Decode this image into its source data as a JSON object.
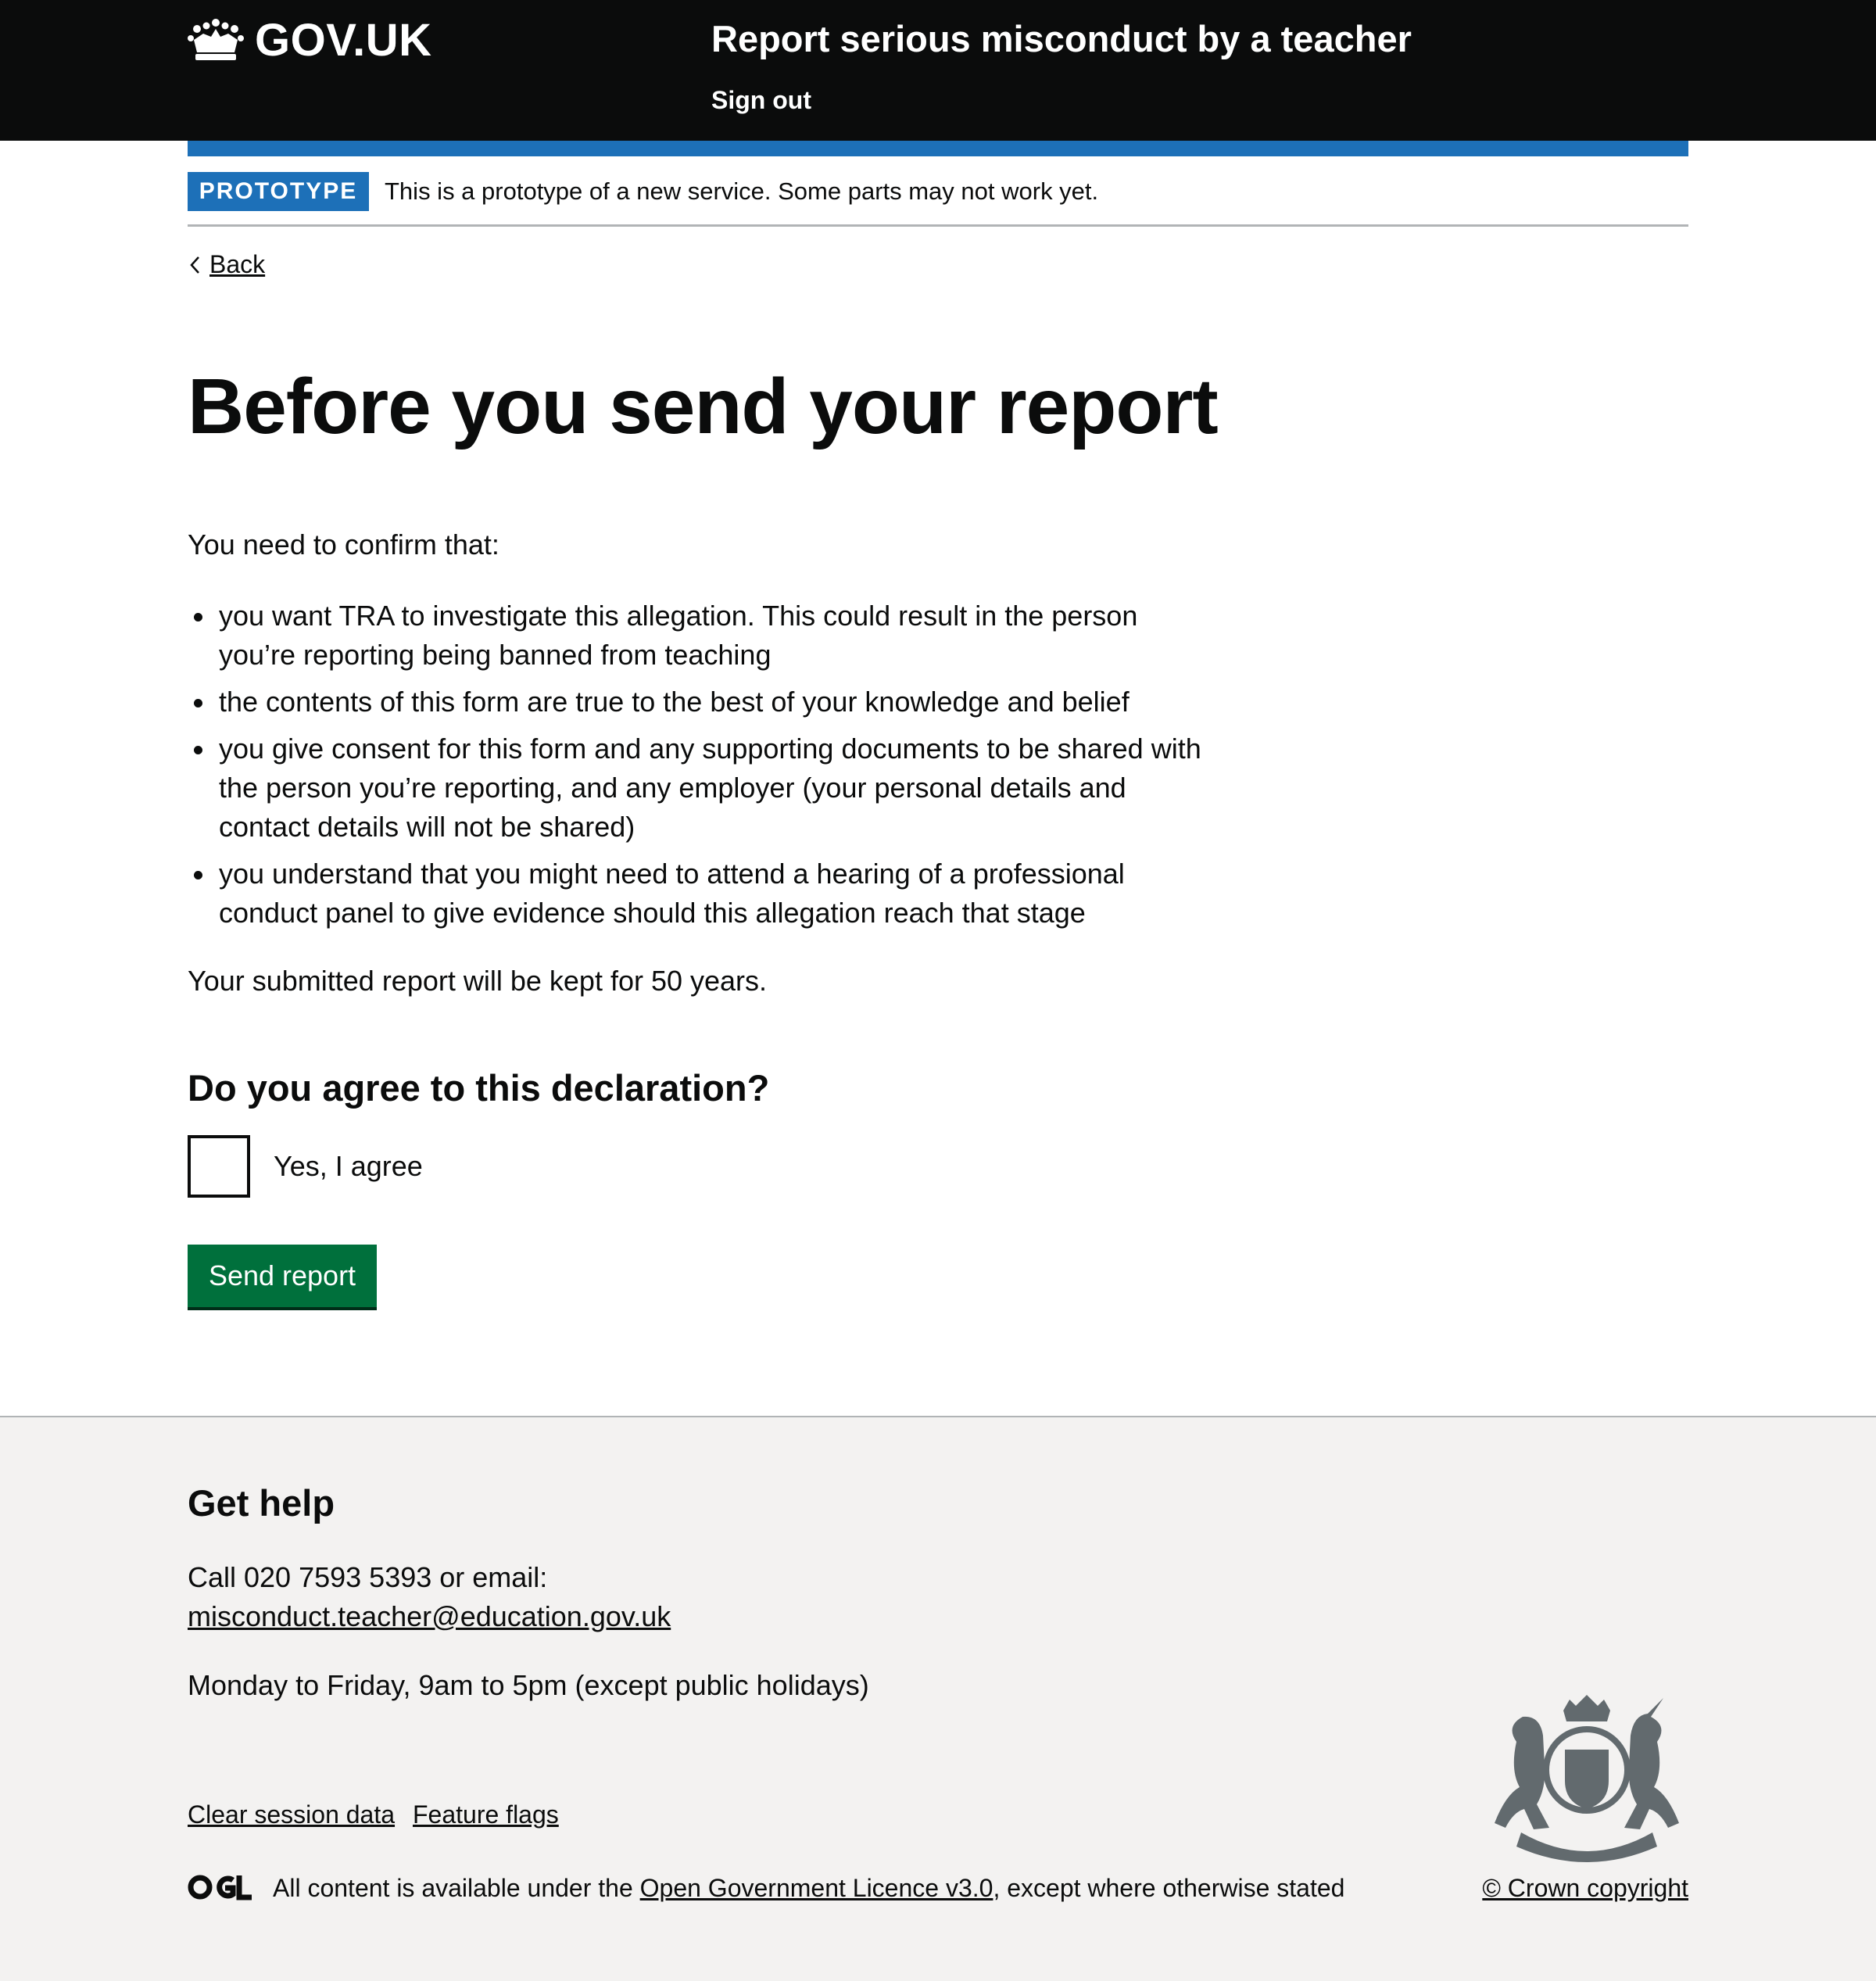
{
  "header": {
    "logo_text": "GOV.UK",
    "service_name": "Report serious misconduct by a teacher",
    "sign_out": "Sign out",
    "background": "#0b0c0c",
    "accent": "#1d70b8"
  },
  "phase_banner": {
    "tag": "PROTOTYPE",
    "text": "This is a prototype of a new service. Some parts may not work yet."
  },
  "back_link": "Back",
  "main": {
    "title": "Before you send your report",
    "intro": "You need to confirm that:",
    "bullets": [
      "you want TRA to investigate this allegation. This could result in the person you’re reporting being banned from teaching",
      "the contents of this form are true to the best of your knowledge and belief",
      "you give consent for this form and any supporting documents to be shared with the person you’re reporting, and any employer (your personal details and contact details will not be shared)",
      "you understand that you might need to attend a hearing of a professional conduct panel to give evidence should this allegation reach that stage"
    ],
    "retention": "Your submitted report will be kept for 50 years.",
    "question": "Do you agree to this declaration?",
    "checkbox_label": "Yes, I agree",
    "checkbox_checked": false,
    "submit_button": "Send report",
    "button_color": "#00703c"
  },
  "footer": {
    "help_heading": "Get help",
    "help_call": "Call 020 7593 5393 or email:",
    "help_email": "misconduct.teacher@education.gov.uk",
    "help_hours": "Monday to Friday, 9am to 5pm (except public holidays)",
    "links": [
      "Clear session data",
      "Feature flags"
    ],
    "licence_prefix": "All content is available under the ",
    "licence_link": "Open Government Licence v3.0",
    "licence_suffix": ", except where otherwise stated",
    "copyright": "© Crown copyright",
    "background": "#f3f2f1"
  }
}
